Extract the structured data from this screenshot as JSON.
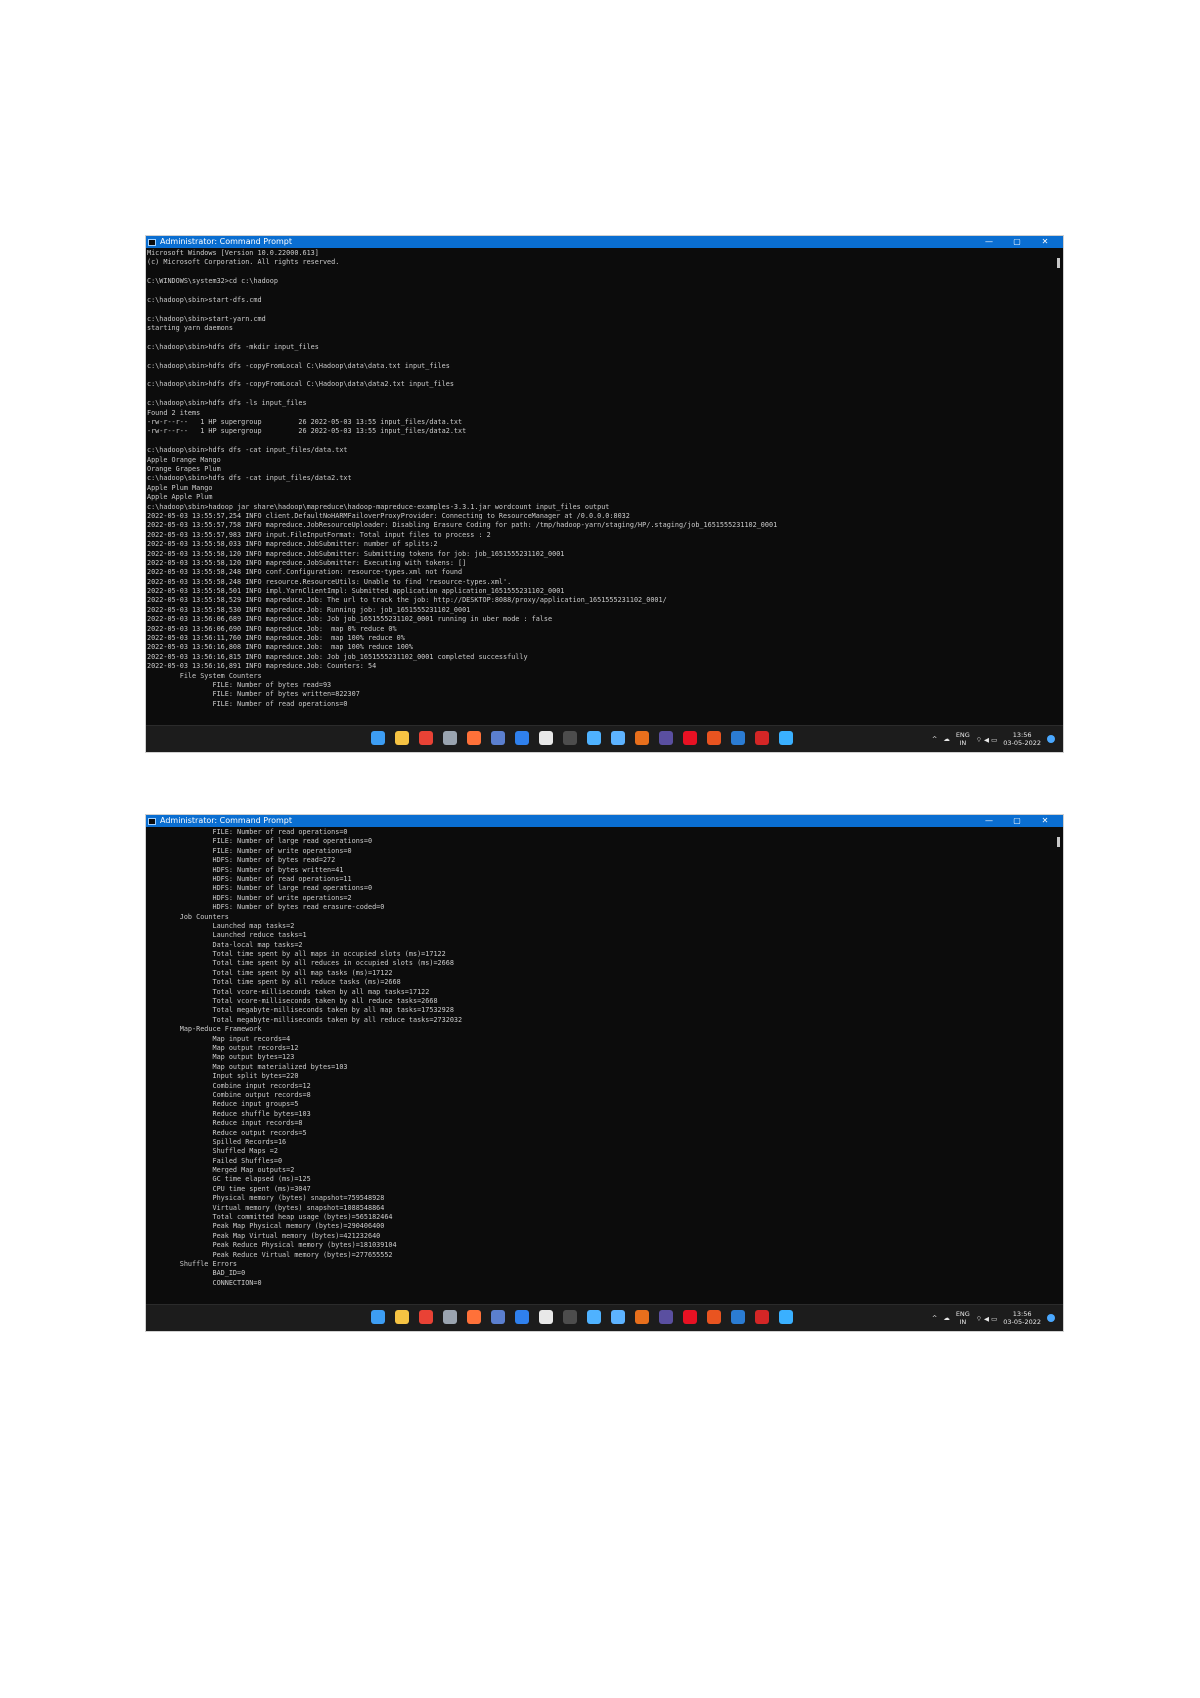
{
  "screenshot1": {
    "title": "Administrator: Command Prompt",
    "controls": {
      "minimize": "—",
      "maximize": "▢",
      "close": "✕"
    },
    "lines": [
      "Microsoft Windows [Version 10.0.22000.613]",
      "(c) Microsoft Corporation. All rights reserved.",
      "",
      "C:\\WINDOWS\\system32>cd c:\\hadoop",
      "",
      "c:\\hadoop\\sbin>start-dfs.cmd",
      "",
      "c:\\hadoop\\sbin>start-yarn.cmd",
      "starting yarn daemons",
      "",
      "c:\\hadoop\\sbin>hdfs dfs -mkdir input_files",
      "",
      "c:\\hadoop\\sbin>hdfs dfs -copyFromLocal C:\\Hadoop\\data\\data.txt input_files",
      "",
      "c:\\hadoop\\sbin>hdfs dfs -copyFromLocal C:\\Hadoop\\data\\data2.txt input_files",
      "",
      "c:\\hadoop\\sbin>hdfs dfs -ls input_files",
      "Found 2 items",
      "-rw-r--r--   1 HP supergroup         26 2022-05-03 13:55 input_files/data.txt",
      "-rw-r--r--   1 HP supergroup         26 2022-05-03 13:55 input_files/data2.txt",
      "",
      "c:\\hadoop\\sbin>hdfs dfs -cat input_files/data.txt",
      "Apple Orange Mango",
      "Orange Grapes Plum",
      "c:\\hadoop\\sbin>hdfs dfs -cat input_files/data2.txt",
      "Apple Plum Mango",
      "Apple Apple Plum",
      "c:\\hadoop\\sbin>hadoop jar share\\hadoop\\mapreduce\\hadoop-mapreduce-examples-3.3.1.jar wordcount input_files output",
      "2022-05-03 13:55:57,254 INFO client.DefaultNoHARMFailoverProxyProvider: Connecting to ResourceManager at /0.0.0.0:8032",
      "2022-05-03 13:55:57,758 INFO mapreduce.JobResourceUploader: Disabling Erasure Coding for path: /tmp/hadoop-yarn/staging/HP/.staging/job_1651555231102_0001",
      "2022-05-03 13:55:57,983 INFO input.FileInputFormat: Total input files to process : 2",
      "2022-05-03 13:55:58,033 INFO mapreduce.JobSubmitter: number of splits:2",
      "2022-05-03 13:55:58,120 INFO mapreduce.JobSubmitter: Submitting tokens for job: job_1651555231102_0001",
      "2022-05-03 13:55:58,120 INFO mapreduce.JobSubmitter: Executing with tokens: []",
      "2022-05-03 13:55:58,248 INFO conf.Configuration: resource-types.xml not found",
      "2022-05-03 13:55:58,248 INFO resource.ResourceUtils: Unable to find 'resource-types.xml'.",
      "2022-05-03 13:55:58,501 INFO impl.YarnClientImpl: Submitted application application_1651555231102_0001",
      "2022-05-03 13:55:58,529 INFO mapreduce.Job: The url to track the job: http://DESKTOP:8088/proxy/application_1651555231102_0001/",
      "2022-05-03 13:55:58,530 INFO mapreduce.Job: Running job: job_1651555231102_0001",
      "2022-05-03 13:56:06,689 INFO mapreduce.Job: Job job_1651555231102_0001 running in uber mode : false",
      "2022-05-03 13:56:06,690 INFO mapreduce.Job:  map 0% reduce 0%",
      "2022-05-03 13:56:11,760 INFO mapreduce.Job:  map 100% reduce 0%",
      "2022-05-03 13:56:16,808 INFO mapreduce.Job:  map 100% reduce 100%",
      "2022-05-03 13:56:16,815 INFO mapreduce.Job: Job job_1651555231102_0001 completed successfully",
      "2022-05-03 13:56:16,891 INFO mapreduce.Job: Counters: 54",
      "        File System Counters",
      "                FILE: Number of bytes read=93",
      "                FILE: Number of bytes written=822307",
      "                FILE: Number of read operations=0"
    ]
  },
  "screenshot2": {
    "title": "Administrator: Command Prompt",
    "controls": {
      "minimize": "—",
      "maximize": "▢",
      "close": "✕"
    },
    "lines": [
      "                FILE: Number of read operations=0",
      "                FILE: Number of large read operations=0",
      "                FILE: Number of write operations=0",
      "                HDFS: Number of bytes read=272",
      "                HDFS: Number of bytes written=41",
      "                HDFS: Number of read operations=11",
      "                HDFS: Number of large read operations=0",
      "                HDFS: Number of write operations=2",
      "                HDFS: Number of bytes read erasure-coded=0",
      "        Job Counters",
      "                Launched map tasks=2",
      "                Launched reduce tasks=1",
      "                Data-local map tasks=2",
      "                Total time spent by all maps in occupied slots (ms)=17122",
      "                Total time spent by all reduces in occupied slots (ms)=2668",
      "                Total time spent by all map tasks (ms)=17122",
      "                Total time spent by all reduce tasks (ms)=2668",
      "                Total vcore-milliseconds taken by all map tasks=17122",
      "                Total vcore-milliseconds taken by all reduce tasks=2668",
      "                Total megabyte-milliseconds taken by all map tasks=17532928",
      "                Total megabyte-milliseconds taken by all reduce tasks=2732032",
      "        Map-Reduce Framework",
      "                Map input records=4",
      "                Map output records=12",
      "                Map output bytes=123",
      "                Map output materialized bytes=103",
      "                Input split bytes=220",
      "                Combine input records=12",
      "                Combine output records=8",
      "                Reduce input groups=5",
      "                Reduce shuffle bytes=103",
      "                Reduce input records=8",
      "                Reduce output records=5",
      "                Spilled Records=16",
      "                Shuffled Maps =2",
      "                Failed Shuffles=0",
      "                Merged Map outputs=2",
      "                GC time elapsed (ms)=125",
      "                CPU time spent (ms)=3047",
      "                Physical memory (bytes) snapshot=759548928",
      "                Virtual memory (bytes) snapshot=1088548864",
      "                Total committed heap usage (bytes)=565182464",
      "                Peak Map Physical memory (bytes)=290406400",
      "                Peak Map Virtual memory (bytes)=421232640",
      "                Peak Reduce Physical memory (bytes)=181039104",
      "                Peak Reduce Virtual memory (bytes)=277655552",
      "        Shuffle Errors",
      "                BAD_ID=0",
      "                CONNECTION=0"
    ]
  },
  "taskbar": {
    "icons": [
      {
        "name": "windows-start-icon",
        "color": "#3d9df3"
      },
      {
        "name": "file-explorer-icon",
        "color": "#f6c343"
      },
      {
        "name": "chrome-icon",
        "color": "#e94235"
      },
      {
        "name": "app-icon-gray",
        "color": "#9aa4b0"
      },
      {
        "name": "firefox-icon",
        "color": "#ff7139"
      },
      {
        "name": "sql-icon",
        "color": "#5b7fcf"
      },
      {
        "name": "vscode-icon",
        "color": "#2f80ed"
      },
      {
        "name": "github-desktop-icon",
        "color": "#e8e8e8"
      },
      {
        "name": "terminal-icon",
        "color": "#4d4d4d"
      },
      {
        "name": "snipping-tool-icon",
        "color": "#4fb2ff"
      },
      {
        "name": "network-icon",
        "color": "#5db3ff"
      },
      {
        "name": "java-icon",
        "color": "#e86f1c"
      },
      {
        "name": "eclipse-icon",
        "color": "#5a4fa0"
      },
      {
        "name": "record-icon",
        "color": "#e81123"
      },
      {
        "name": "ubuntu-icon",
        "color": "#e95420"
      },
      {
        "name": "word-icon",
        "color": "#2b7cd3"
      },
      {
        "name": "acrobat-icon",
        "color": "#d42626"
      },
      {
        "name": "notepad-icon",
        "color": "#3ab0ff"
      }
    ],
    "tray": {
      "chevron": "^",
      "cloud": "☁",
      "lang_top": "ENG",
      "lang_bottom": "IN",
      "status": "⌔ ◀ ▭",
      "time": "13:56",
      "date": "03-05-2022"
    }
  }
}
